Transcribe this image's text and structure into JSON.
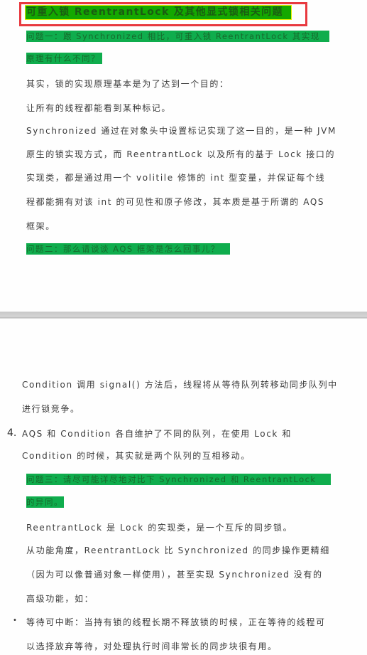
{
  "document": {
    "title": "可重入锁  ReentrantLock  及其他显式锁相关问题",
    "colors": {
      "title_box_border": "#e8393f",
      "title_highlight": "#13a800",
      "question_highlight": "#0fad4d",
      "question_text": "#17692b",
      "body_text": "#3a3a3a"
    },
    "page1": {
      "question1": {
        "line1": "问题一：跟  Synchronized  相比，可重入锁  ReentrantLock  其实现",
        "line2": "原理有什么不同？"
      },
      "paragraphs": [
        "其实，锁的实现原理基本是为了达到一个目的：",
        "让所有的线程都能看到某种标记。",
        "Synchronized 通过在对象头中设置标记实现了这一目的，是一种 JVM",
        "原生的锁实现方式，而 ReentrantLock 以及所有的基于 Lock 接口的",
        "实现类，都是通过用一个  volitile  修饰的  int  型变量，并保证每个线",
        "程都能拥有对该  int  的可见性和原子修改，其本质是基于所谓的  AQS",
        "框架。"
      ],
      "question2": "问题二：那么请谈谈  AQS  框架是怎么回事儿？"
    },
    "page2": {
      "paragraphs_top": [
        "Condition  调用  signal()  方法后，线程将从等待队列转移动同步队列中",
        "进行锁竞争。"
      ],
      "item4": {
        "marker": "4.",
        "line1": "AQS    和    Condition    各自维护了不同的队列，在使用    Lock    和",
        "line2": "Condition 的时候，其实就是两个队列的互相移动。"
      },
      "question3": {
        "line1": "问题三：请尽可能详尽地对比下   Synchronized   和   ReentrantLock",
        "line2": "的异同。"
      },
      "paragraphs_bottom": [
        "ReentrantLock 是 Lock 的实现类，是一个互斥的同步锁。",
        "从功能角度，ReentrantLock   比   Synchronized   的同步操作更精细",
        "（因为可以像普通对象一样使用），甚至实现   Synchronized   没有的",
        "高级功能，如："
      ],
      "bullet_item": {
        "marker": "•",
        "line1": "等待可中断：当持有锁的线程长期不释放锁的时候，正在等待的线程可",
        "line2": "以选择放弃等待，对处理执行时间非常长的同步块很有用。"
      }
    }
  }
}
